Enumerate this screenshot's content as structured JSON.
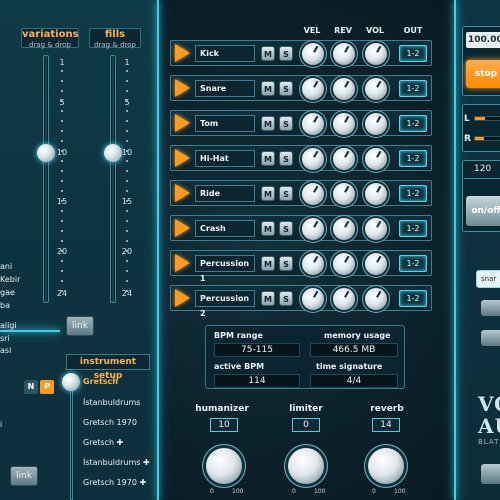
{
  "left": {
    "variations": {
      "title": "variations",
      "subtitle": "drag & drop"
    },
    "fills": {
      "title": "fills",
      "subtitle": "drag & drop"
    },
    "scale": [
      "1",
      "5",
      "10",
      "15",
      "20",
      "24"
    ],
    "link_label": "link",
    "side_labels_top": [
      "ani",
      "Kebir",
      "gae",
      "ba"
    ],
    "side_labels_mid": [
      "aligi",
      "sri",
      "asi"
    ],
    "side_labels_low": [
      "i"
    ],
    "np": {
      "n": "N",
      "p": "P"
    },
    "instrument_setup": {
      "title": "instrument setup",
      "items": [
        {
          "label": "Gretsch",
          "selected": true
        },
        {
          "label": "İstanbuldrums"
        },
        {
          "label": "Gretsch 1970"
        },
        {
          "label": "Gretsch ✚"
        },
        {
          "label": "İstanbuldrums ✚"
        },
        {
          "label": "Gretsch 1970 ✚"
        }
      ]
    }
  },
  "mixer": {
    "columns": {
      "vel": "VEL",
      "rev": "REV",
      "vol": "VOL",
      "out": "OUT"
    },
    "mute_label": "M",
    "solo_label": "S",
    "rows": [
      {
        "name": "Kick",
        "out": "1-2"
      },
      {
        "name": "Snare",
        "out": "1-2"
      },
      {
        "name": "Tom",
        "out": "1-2"
      },
      {
        "name": "Hi-Hat",
        "out": "1-2"
      },
      {
        "name": "Ride",
        "out": "1-2"
      },
      {
        "name": "Crash",
        "out": "1-2"
      },
      {
        "name": "Percussion 1",
        "out": "1-2"
      },
      {
        "name": "Percussion 2",
        "out": "1-2"
      }
    ]
  },
  "info": {
    "bpm_range_label": "BPM range",
    "bpm_range_value": "75-115",
    "memory_label": "memory usage",
    "memory_value": "466.5 MB",
    "active_bpm_label": "active BPM",
    "active_bpm_value": "114",
    "time_sig_label": "time signature",
    "time_sig_value": "4/4"
  },
  "knobs": [
    {
      "title": "humanizer",
      "value": "10",
      "min": "0",
      "max": "100"
    },
    {
      "title": "limiter",
      "value": "0",
      "min": "0",
      "max": "100"
    },
    {
      "title": "reverb",
      "value": "14",
      "min": "0",
      "max": "100"
    }
  ],
  "right": {
    "tempo_value": "100.00",
    "stop_label": "stop",
    "l_label": "L",
    "r_label": "R",
    "bpm_small": "120",
    "onoff_label": "on/off",
    "snare_label": "snar",
    "logo_lines": [
      "VO",
      "AU",
      "BLAT"
    ]
  },
  "colors": {
    "accent": "#ff9a1f",
    "glow": "#3fd0e8"
  }
}
